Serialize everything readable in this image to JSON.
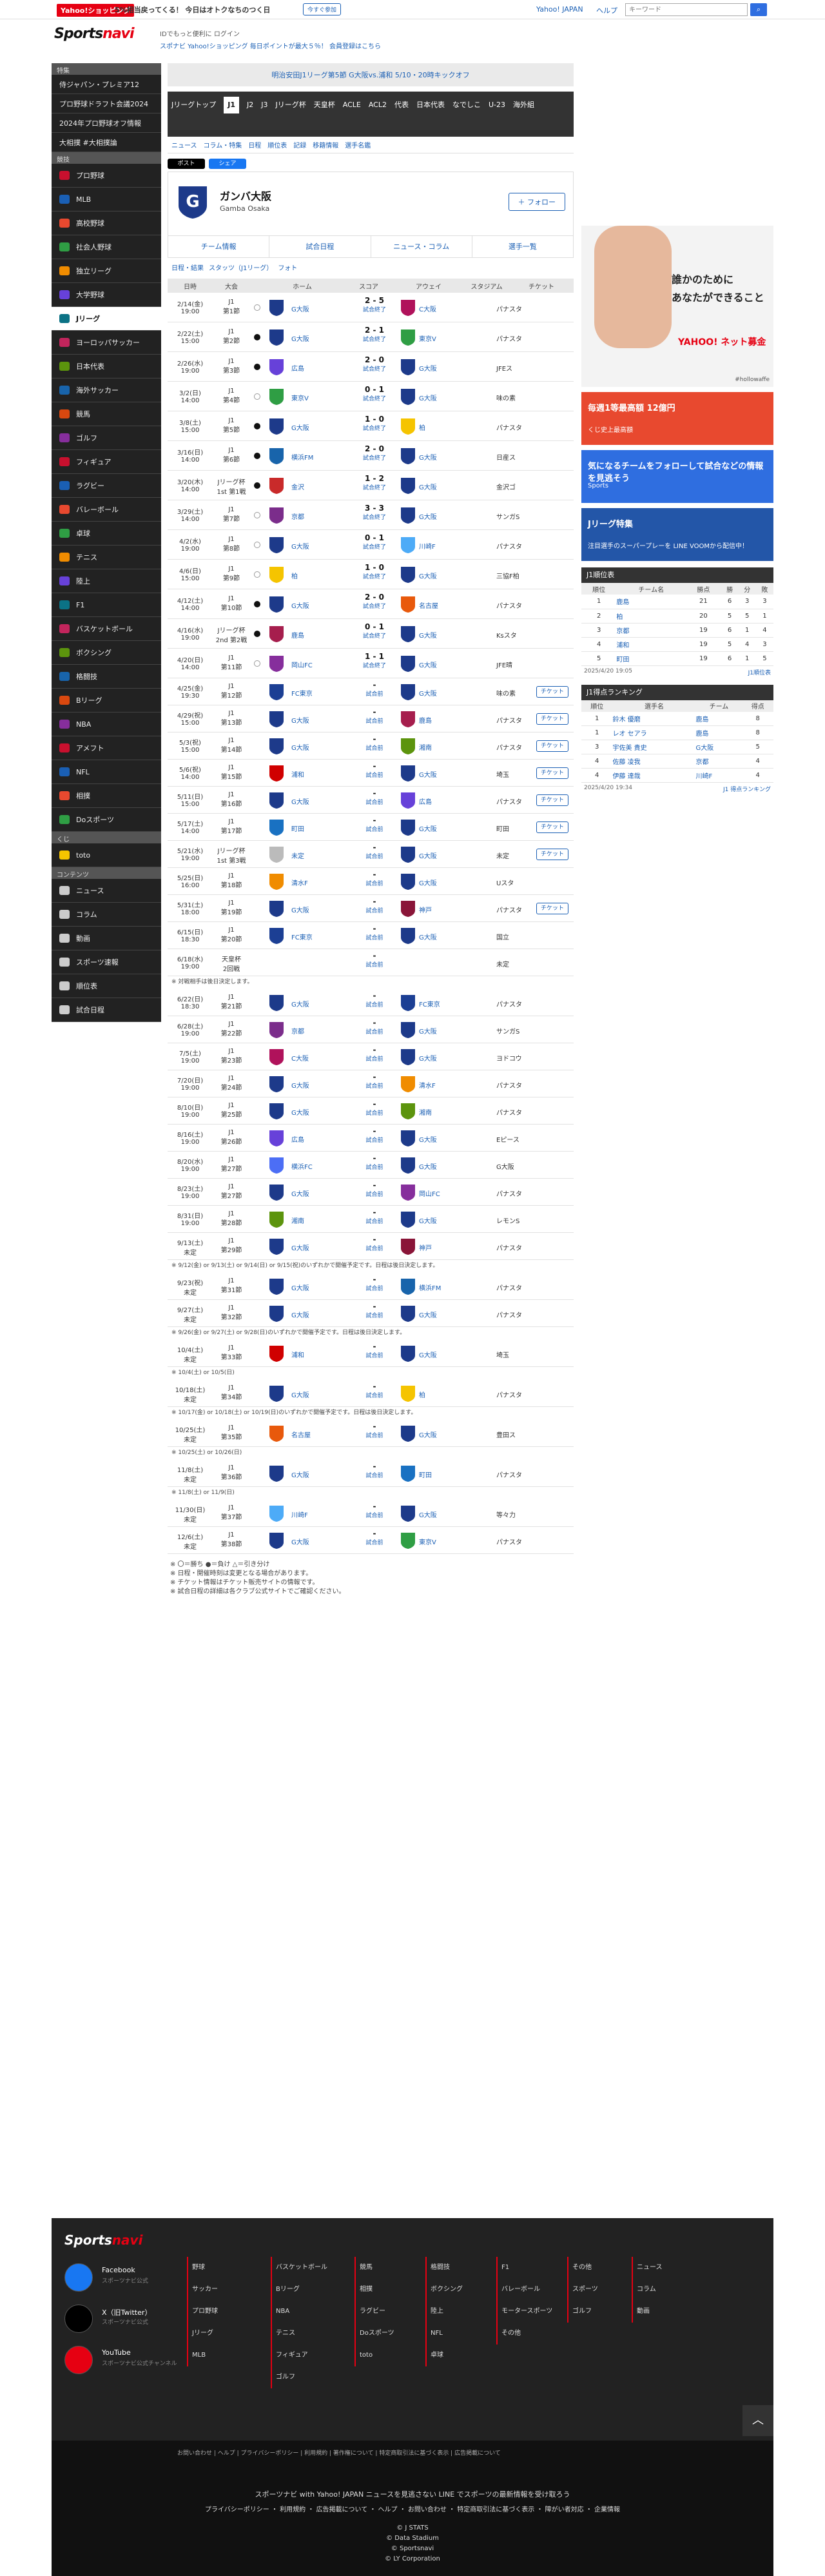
{
  "topbar": {
    "shop": "Yahoo!ショッピング",
    "promo": "5%相当戻ってくる！ 今日はオトクなちのつく日",
    "promo_btn": "今すぐ参加",
    "yj": "Yahoo! JAPAN",
    "help": "ヘルプ",
    "search_ph": "キーワード"
  },
  "brand": {
    "logo_a": "Sports",
    "logo_b": "navi",
    "login_note": "IDでもっと便利に ログイン",
    "promo_note": "スポナビ Yahoo!ショッピング 毎日ポイントが最大５％！ 会員登録はこちら"
  },
  "sidebar": {
    "header1": "特集",
    "top_items": [
      "侍ジャパン・プレミア12",
      "プロ野球ドラフト会議2024",
      "2024年プロ野球オフ情報",
      "大相撲 #大相撲論"
    ],
    "header2": "競技",
    "items": [
      "プロ野球",
      "MLB",
      "高校野球",
      "社会人野球",
      "独立リーグ",
      "大学野球",
      "Jリーグ",
      "ヨーロッパサッカー",
      "日本代表",
      "海外サッカー",
      "競馬",
      "ゴルフ",
      "フィギュア",
      "ラグビー",
      "バレーボール",
      "卓球",
      "テニス",
      "陸上",
      "F1",
      "バスケットボール",
      "ボクシング",
      "格闘技",
      "Bリーグ",
      "NBA",
      "アメフト",
      "NFL",
      "相撲",
      "Doスポーツ"
    ],
    "header3": "くじ",
    "toto": "toto",
    "header4": "コンテンツ",
    "bottom": [
      "ニュース",
      "コラム",
      "動画",
      "スポーツ速報",
      "順位表",
      "試合日程"
    ]
  },
  "banner": "明治安田J1リーグ第5節 G大阪vs.浦和 5/10・20時キックオフ",
  "leaguenav": [
    "Jリーグトップ",
    "J1",
    "J2",
    "J3",
    "Jリーグ杯",
    "天皇杯",
    "ACLE",
    "ACL2",
    "代表",
    "日本代表",
    "なでしこ",
    "U-23",
    "海外組"
  ],
  "subnav": [
    "ニュース",
    "コラム・特集",
    "日程",
    "順位表",
    "記録",
    "移籍情報",
    "選手名鑑"
  ],
  "share": {
    "x": "ポスト",
    "fb": "シェア"
  },
  "team": {
    "name": "ガンバ大阪",
    "en": "Gamba Osaka",
    "follow": "＋ フォロー"
  },
  "tabs": [
    "チーム情報",
    "試合日程",
    "ニュース・コラム",
    "選手一覧"
  ],
  "subtabs": [
    "日程・結果",
    "スタッツ（J1リーグ）",
    "フォト"
  ],
  "headers": [
    "日時",
    "大会",
    "",
    "ホーム",
    "スコア",
    "アウェイ",
    "スタジアム",
    "チケット"
  ],
  "matches": [
    {
      "d": "2/14(金)",
      "t": "19:00",
      "comp": "J1",
      "rd": "第1節",
      "res": "L",
      "home": "G大阪",
      "sc": "2 - 5",
      "sub": "試合終了",
      "away": "C大阪",
      "st": "パナスタ",
      "tk": ""
    },
    {
      "d": "2/22(土)",
      "t": "15:00",
      "comp": "J1",
      "rd": "第2節",
      "res": "W",
      "home": "G大阪",
      "sc": "2 - 1",
      "sub": "試合終了",
      "away": "東京V",
      "st": "パナスタ",
      "tk": ""
    },
    {
      "d": "2/26(水)",
      "t": "19:00",
      "comp": "J1",
      "rd": "第3節",
      "res": "W",
      "home": "広島",
      "sc": "2 - 0",
      "sub": "試合終了",
      "away": "G大阪",
      "st": "JFEス",
      "tk": ""
    },
    {
      "d": "3/2(日)",
      "t": "14:00",
      "comp": "J1",
      "rd": "第4節",
      "res": "L",
      "home": "東京V",
      "sc": "0 - 1",
      "sub": "試合終了",
      "away": "G大阪",
      "st": "味の素",
      "tk": ""
    },
    {
      "d": "3/8(土)",
      "t": "15:00",
      "comp": "J1",
      "rd": "第5節",
      "res": "W",
      "home": "G大阪",
      "sc": "1 - 0",
      "sub": "試合終了",
      "away": "柏",
      "st": "パナスタ",
      "tk": ""
    },
    {
      "d": "3/16(日)",
      "t": "14:00",
      "comp": "J1",
      "rd": "第6節",
      "res": "W",
      "home": "横浜FM",
      "sc": "2 - 0",
      "sub": "試合終了",
      "away": "G大阪",
      "st": "日産ス",
      "tk": ""
    },
    {
      "d": "3/20(木)",
      "t": "14:00",
      "comp": "Jリーグ杯",
      "rd": "1st 第1戦",
      "res": "W",
      "home": "金沢",
      "sc": "1 - 2",
      "sub": "試合終了",
      "away": "G大阪",
      "st": "金沢ゴ",
      "tk": ""
    },
    {
      "d": "3/29(土)",
      "t": "14:00",
      "comp": "J1",
      "rd": "第7節",
      "res": "D",
      "home": "京都",
      "sc": "3 - 3",
      "sub": "試合終了",
      "away": "G大阪",
      "st": "サンガS",
      "tk": ""
    },
    {
      "d": "4/2(水)",
      "t": "19:00",
      "comp": "J1",
      "rd": "第8節",
      "res": "L",
      "home": "G大阪",
      "sc": "0 - 1",
      "sub": "試合終了",
      "away": "川崎F",
      "st": "パナスタ",
      "tk": ""
    },
    {
      "d": "4/6(日)",
      "t": "15:00",
      "comp": "J1",
      "rd": "第9節",
      "res": "L",
      "home": "柏",
      "sc": "1 - 0",
      "sub": "試合終了",
      "away": "G大阪",
      "st": "三協F柏",
      "tk": ""
    },
    {
      "d": "4/12(土)",
      "t": "14:00",
      "comp": "J1",
      "rd": "第10節",
      "res": "W",
      "home": "G大阪",
      "sc": "2 - 0",
      "sub": "試合終了",
      "away": "名古屋",
      "st": "パナスタ",
      "tk": ""
    },
    {
      "d": "4/16(水)",
      "t": "19:00",
      "comp": "Jリーグ杯",
      "rd": "2nd 第2戦",
      "res": "W",
      "home": "鹿島",
      "sc": "0 - 1",
      "sub": "試合終了",
      "away": "G大阪",
      "st": "Ksスタ",
      "tk": ""
    },
    {
      "d": "4/20(日)",
      "t": "14:00",
      "comp": "J1",
      "rd": "第11節",
      "res": "D",
      "home": "岡山FC",
      "sc": "1 - 1",
      "sub": "試合終了",
      "away": "G大阪",
      "st": "JFE晴",
      "tk": ""
    },
    {
      "d": "4/25(金)",
      "t": "19:30",
      "comp": "J1",
      "rd": "第12節",
      "res": "",
      "home": "FC東京",
      "sc": "-",
      "sub": "試合前",
      "away": "G大阪",
      "st": "味の素",
      "tk": "チケット"
    },
    {
      "d": "4/29(祝)",
      "t": "15:00",
      "comp": "J1",
      "rd": "第13節",
      "res": "",
      "home": "G大阪",
      "sc": "-",
      "sub": "試合前",
      "away": "鹿島",
      "st": "パナスタ",
      "tk": "チケット"
    },
    {
      "d": "5/3(祝)",
      "t": "15:00",
      "comp": "J1",
      "rd": "第14節",
      "res": "",
      "home": "G大阪",
      "sc": "-",
      "sub": "試合前",
      "away": "湘南",
      "st": "パナスタ",
      "tk": "チケット"
    },
    {
      "d": "5/6(祝)",
      "t": "14:00",
      "comp": "J1",
      "rd": "第15節",
      "res": "",
      "home": "浦和",
      "sc": "-",
      "sub": "試合前",
      "away": "G大阪",
      "st": "埼玉",
      "tk": "チケット"
    },
    {
      "d": "5/11(日)",
      "t": "15:00",
      "comp": "J1",
      "rd": "第16節",
      "res": "",
      "home": "G大阪",
      "sc": "-",
      "sub": "試合前",
      "away": "広島",
      "st": "パナスタ",
      "tk": "チケット"
    },
    {
      "d": "5/17(土)",
      "t": "14:00",
      "comp": "J1",
      "rd": "第17節",
      "res": "",
      "home": "町田",
      "sc": "-",
      "sub": "試合前",
      "away": "G大阪",
      "st": "町田",
      "tk": "チケット"
    },
    {
      "d": "5/21(水)",
      "t": "19:00",
      "comp": "Jリーグ杯",
      "rd": "1st 第3戦",
      "res": "",
      "home": "未定",
      "sc": "-",
      "sub": "試合前",
      "away": "G大阪",
      "st": "未定",
      "tk": "チケット"
    },
    {
      "d": "5/25(日)",
      "t": "16:00",
      "comp": "J1",
      "rd": "第18節",
      "res": "",
      "home": "清水F",
      "sc": "-",
      "sub": "試合前",
      "away": "G大阪",
      "st": "Uスタ",
      "tk": ""
    },
    {
      "d": "5/31(土)",
      "t": "18:00",
      "comp": "J1",
      "rd": "第19節",
      "res": "",
      "home": "G大阪",
      "sc": "-",
      "sub": "試合前",
      "away": "神戸",
      "st": "パナスタ",
      "tk": "チケット"
    },
    {
      "d": "6/15(日)",
      "t": "18:30",
      "comp": "J1",
      "rd": "第20節",
      "res": "",
      "home": "FC東京",
      "sc": "-",
      "sub": "試合前",
      "away": "G大阪",
      "st": "国立",
      "tk": ""
    },
    {
      "d": "6/18(水)",
      "t": "19:00",
      "comp": "天皇杯",
      "rd": "2回戦",
      "res": "",
      "home": "",
      "sc": "-",
      "sub": "試合前",
      "away": "",
      "st": "未定",
      "tk": "",
      "note": "※ 対戦相手は後日決定します。"
    },
    {
      "d": "6/22(日)",
      "t": "18:30",
      "comp": "J1",
      "rd": "第21節",
      "res": "",
      "home": "G大阪",
      "sc": "-",
      "sub": "試合前",
      "away": "FC東京",
      "st": "パナスタ",
      "tk": ""
    },
    {
      "d": "6/28(土)",
      "t": "19:00",
      "comp": "J1",
      "rd": "第22節",
      "res": "",
      "home": "京都",
      "sc": "-",
      "sub": "試合前",
      "away": "G大阪",
      "st": "サンガS",
      "tk": ""
    },
    {
      "d": "7/5(土)",
      "t": "19:00",
      "comp": "J1",
      "rd": "第23節",
      "res": "",
      "home": "C大阪",
      "sc": "-",
      "sub": "試合前",
      "away": "G大阪",
      "st": "ヨドコウ",
      "tk": ""
    },
    {
      "d": "7/20(日)",
      "t": "19:00",
      "comp": "J1",
      "rd": "第24節",
      "res": "",
      "home": "G大阪",
      "sc": "-",
      "sub": "試合前",
      "away": "清水F",
      "st": "パナスタ",
      "tk": ""
    },
    {
      "d": "8/10(日)",
      "t": "19:00",
      "comp": "J1",
      "rd": "第25節",
      "res": "",
      "home": "G大阪",
      "sc": "-",
      "sub": "試合前",
      "away": "湘南",
      "st": "パナスタ",
      "tk": ""
    },
    {
      "d": "8/16(土)",
      "t": "19:00",
      "comp": "J1",
      "rd": "第26節",
      "res": "",
      "home": "広島",
      "sc": "-",
      "sub": "試合前",
      "away": "G大阪",
      "st": "Eピース",
      "tk": ""
    },
    {
      "d": "8/20(水)",
      "t": "19:00",
      "comp": "J1",
      "rd": "第27節",
      "res": "",
      "home": "横浜FC",
      "sc": "-",
      "sub": "試合前",
      "away": "G大阪",
      "st": "G大阪",
      "tk": ""
    },
    {
      "d": "8/23(土)",
      "t": "19:00",
      "comp": "J1",
      "rd": "第27節",
      "res": "",
      "home": "G大阪",
      "sc": "-",
      "sub": "試合前",
      "away": "岡山FC",
      "st": "パナスタ",
      "tk": ""
    },
    {
      "d": "8/31(日)",
      "t": "19:00",
      "comp": "J1",
      "rd": "第28節",
      "res": "",
      "home": "湘南",
      "sc": "-",
      "sub": "試合前",
      "away": "G大阪",
      "st": "レモンS",
      "tk": ""
    },
    {
      "d": "9/13(土)",
      "t": "未定",
      "comp": "J1",
      "rd": "第29節",
      "res": "",
      "home": "G大阪",
      "sc": "-",
      "sub": "試合前",
      "away": "神戸",
      "st": "パナスタ",
      "tk": "",
      "note": "※ 9/12(金) or 9/13(土) or 9/14(日) or 9/15(祝)のいずれかで開催予定です。日程は後日決定します。"
    },
    {
      "d": "9/23(祝)",
      "t": "未定",
      "comp": "J1",
      "rd": "第31節",
      "res": "",
      "home": "G大阪",
      "sc": "-",
      "sub": "試合前",
      "away": "横浜FM",
      "st": "パナスタ",
      "tk": ""
    },
    {
      "d": "9/27(土)",
      "t": "未定",
      "comp": "J1",
      "rd": "第32節",
      "res": "",
      "home": "G大阪",
      "sc": "-",
      "sub": "試合前",
      "away": "G大阪",
      "st": "パナスタ",
      "tk": "",
      "note": "※ 9/26(金) or 9/27(土) or 9/28(日)のいずれかで開催予定です。日程は後日決定します。"
    },
    {
      "d": "10/4(土)",
      "t": "未定",
      "comp": "J1",
      "rd": "第33節",
      "res": "",
      "home": "浦和",
      "sc": "-",
      "sub": "試合前",
      "away": "G大阪",
      "st": "埼玉",
      "tk": "",
      "note": "※ 10/4(土) or 10/5(日)"
    },
    {
      "d": "10/18(土)",
      "t": "未定",
      "comp": "J1",
      "rd": "第34節",
      "res": "",
      "home": "G大阪",
      "sc": "-",
      "sub": "試合前",
      "away": "柏",
      "st": "パナスタ",
      "tk": "",
      "note": "※ 10/17(金) or 10/18(土) or 10/19(日)のいずれかで開催予定です。日程は後日決定します。"
    },
    {
      "d": "10/25(土)",
      "t": "未定",
      "comp": "J1",
      "rd": "第35節",
      "res": "",
      "home": "名古屋",
      "sc": "-",
      "sub": "試合前",
      "away": "G大阪",
      "st": "豊田ス",
      "tk": "",
      "note": "※ 10/25(土) or 10/26(日)"
    },
    {
      "d": "11/8(土)",
      "t": "未定",
      "comp": "J1",
      "rd": "第36節",
      "res": "",
      "home": "G大阪",
      "sc": "-",
      "sub": "試合前",
      "away": "町田",
      "st": "パナスタ",
      "tk": "",
      "note": "※ 11/8(土) or 11/9(日)"
    },
    {
      "d": "11/30(日)",
      "t": "未定",
      "comp": "J1",
      "rd": "第37節",
      "res": "",
      "home": "川崎F",
      "sc": "-",
      "sub": "試合前",
      "away": "G大阪",
      "st": "等々力",
      "tk": ""
    },
    {
      "d": "12/6(土)",
      "t": "未定",
      "comp": "J1",
      "rd": "第38節",
      "res": "",
      "home": "G大阪",
      "sc": "-",
      "sub": "試合前",
      "away": "東京V",
      "st": "パナスタ",
      "tk": ""
    }
  ],
  "legend": [
    "※ 〇＝勝ち ●＝負け △＝引き分け",
    "※ 日程・開催時刻は変更となる場合があります。",
    "※ チケット情報はチケット販売サイトの情報です。",
    "※ 試合日程の詳細は各クラブ公式サイトでご確認ください。"
  ],
  "ad": {
    "line1": "誰かのために",
    "line2": "あなたができること",
    "brand": "YAHOO! ネット募金",
    "credit": "#hollowaffe"
  },
  "small_ads": [
    {
      "title": "毎週1等最高額 12億円",
      "sub": "くじ史上最高額",
      "color": "#e8492f"
    },
    {
      "title": "気になるチームをフォローして試合などの情報を見逃そう",
      "sub": "Sports",
      "color": "#2f6ee0"
    },
    {
      "title": "Jリーグ特集",
      "sub": "注目選手のスーパープレーを LINE VOOMから配信中！",
      "color": "#2356a8"
    }
  ],
  "standings": {
    "title": "J1順位表",
    "cols": [
      "順位",
      "チーム名",
      "勝点",
      "勝",
      "分",
      "敗"
    ],
    "rows": [
      [
        "1",
        "鹿島",
        "21",
        "6",
        "3",
        "3"
      ],
      [
        "2",
        "柏",
        "20",
        "5",
        "5",
        "1"
      ],
      [
        "3",
        "京都",
        "19",
        "6",
        "1",
        "4"
      ],
      [
        "4",
        "浦和",
        "19",
        "5",
        "4",
        "3"
      ],
      [
        "5",
        "町田",
        "19",
        "6",
        "1",
        "5"
      ]
    ],
    "date": "2025/4/20 19:05",
    "link": "J1順位表"
  },
  "scorers": {
    "title": "J1得点ランキング",
    "cols": [
      "順位",
      "選手名",
      "チーム",
      "得点"
    ],
    "rows": [
      [
        "1",
        "鈴木 優磨",
        "鹿島",
        "8"
      ],
      [
        "1",
        "レオ セアラ",
        "鹿島",
        "8"
      ],
      [
        "3",
        "宇佐美 貴史",
        "G大阪",
        "5"
      ],
      [
        "4",
        "佐藤 凌我",
        "京都",
        "4"
      ],
      [
        "4",
        "伊藤 達哉",
        "川崎F",
        "4"
      ]
    ],
    "date": "2025/4/20 19:34",
    "link": "J1 得点ランキング"
  },
  "footer": {
    "logo_a": "Sports",
    "logo_b": "navi",
    "sns": [
      {
        "n": "Facebook",
        "s": "スポーツナビ公式"
      },
      {
        "n": "X（旧Twitter）",
        "s": "スポーツナビ公式"
      },
      {
        "n": "YouTube",
        "s": "スポーツナビ公式チャンネル"
      }
    ],
    "col1": [
      "野球",
      "サッカー",
      "プロ野球",
      "Jリーグ",
      "MLB"
    ],
    "col2": [
      "バスケットボール",
      "Bリーグ",
      "NBA",
      "テニス",
      "フィギュア",
      "ゴルフ"
    ],
    "col3": [
      "競馬",
      "相撲",
      "ラグビー",
      "Doスポーツ",
      "toto"
    ],
    "col4": [
      "格闘技",
      "ボクシング",
      "陸上",
      "NFL",
      "卓球"
    ],
    "col5": [
      "F1",
      "バレーボール",
      "モータースポーツ",
      "その他"
    ],
    "col6": [
      "その他",
      "スポーツ",
      "ゴルフ"
    ],
    "col7": [
      "ニュース",
      "コラム",
      "動画"
    ],
    "corp": "お問い合わせ | ヘルプ | プライバシーポリシー | 利用規約 | 著作権について | 特定商取引法に基づく表示 | 広告掲載について",
    "line1": "スポーツナビ with Yahoo! JAPAN ニュースを見逃さない LINE でスポーツの最新情報を受け取ろう",
    "line2": "プライバシーポリシー ・ 利用規約 ・ 広告掲載について ・ ヘルプ ・ お問い合わせ ・ 特定商取引法に基づく表示 ・ 障がい者対応 ・ 企業情報",
    "c1": "© J STATS",
    "c2": "© Data Stadium",
    "c3": "© Sportsnavi",
    "c4": "© LY Corporation",
    "pagetop": "︿"
  }
}
